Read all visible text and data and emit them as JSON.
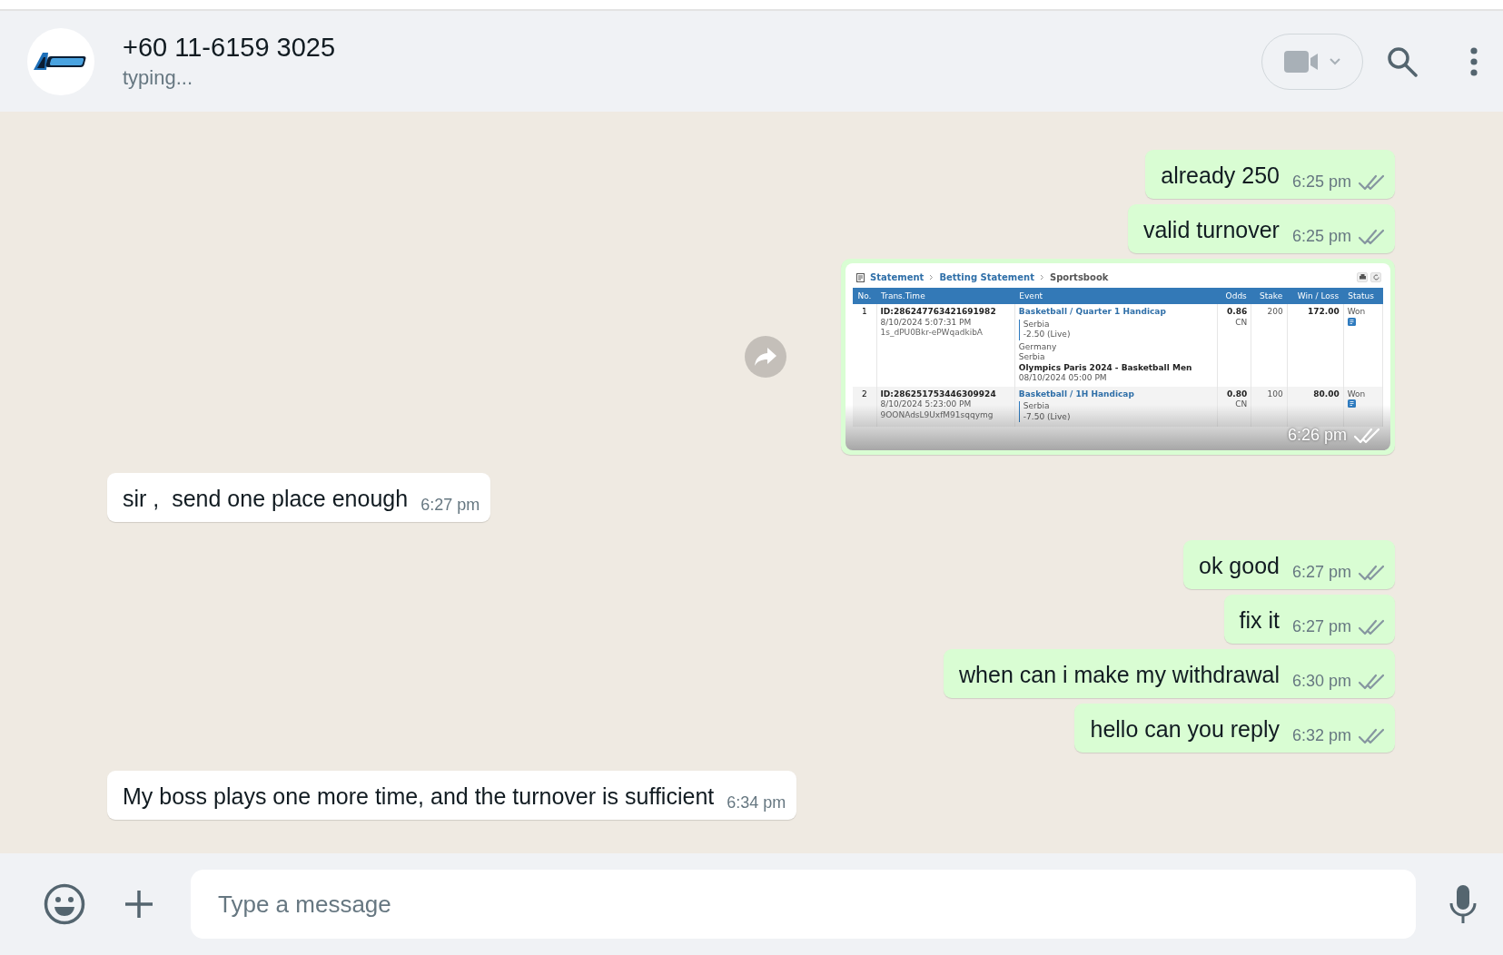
{
  "header": {
    "name": "+60 11-6159 3025",
    "status": "typing..."
  },
  "messages": [
    {
      "kind": "text",
      "outgoing": true,
      "text": "already 250",
      "time": "6:25 pm",
      "read": false
    },
    {
      "kind": "text",
      "outgoing": true,
      "text": "valid turnover",
      "time": "6:25 pm",
      "read": false
    },
    {
      "kind": "image",
      "outgoing": true,
      "time": "6:26 pm",
      "read": false,
      "statement": {
        "breadcrumb": [
          "Statement",
          "Betting Statement",
          "Sportsbook"
        ],
        "columns": [
          "No.",
          "Trans.Time",
          "Event",
          "Odds",
          "Stake",
          "Win / Loss",
          "Status"
        ],
        "rows": [
          {
            "no": "1",
            "id": "ID:286247763421691982",
            "time": "8/10/2024 5:07:31 PM",
            "ref": "1s_dPU0Bkr-ePWqadkibA",
            "event": "Basketball / Quarter 1 Handicap",
            "selection": "Serbia",
            "line": "-2.50 (Live)",
            "teams": [
              "Germany",
              "Serbia"
            ],
            "league": "Olympics Paris 2024 - Basketball Men",
            "match_time": "08/10/2024 05:00 PM",
            "odds": "0.86",
            "odds_type": "CN",
            "stake": "200",
            "win_loss": "172.00",
            "status": "Won"
          },
          {
            "no": "2",
            "id": "ID:286251753446309924",
            "time": "8/10/2024 5:23:00 PM",
            "ref": "9OONAdsL9UxfM91sqqymg",
            "event": "Basketball / 1H Handicap",
            "selection": "Serbia",
            "line": "-7.50 (Live)",
            "teams": [],
            "odds": "0.80",
            "odds_type": "CN",
            "stake": "100",
            "win_loss": "80.00",
            "status": "Won"
          }
        ]
      }
    },
    {
      "kind": "text",
      "outgoing": false,
      "text": "sir ,  send one place enough",
      "time": "6:27 pm"
    },
    {
      "kind": "text",
      "outgoing": true,
      "text": "ok good",
      "time": "6:27 pm",
      "read": false
    },
    {
      "kind": "text",
      "outgoing": true,
      "text": "fix it",
      "time": "6:27 pm",
      "read": false
    },
    {
      "kind": "text",
      "outgoing": true,
      "text": "when can i make my withdrawal",
      "time": "6:30 pm",
      "read": false
    },
    {
      "kind": "text",
      "outgoing": true,
      "text": "hello can you reply",
      "time": "6:32 pm",
      "read": false
    },
    {
      "kind": "text",
      "outgoing": false,
      "text": "My boss plays one more time, and the turnover is sufficient",
      "time": "6:34 pm"
    }
  ],
  "composer": {
    "placeholder": "Type a message"
  }
}
